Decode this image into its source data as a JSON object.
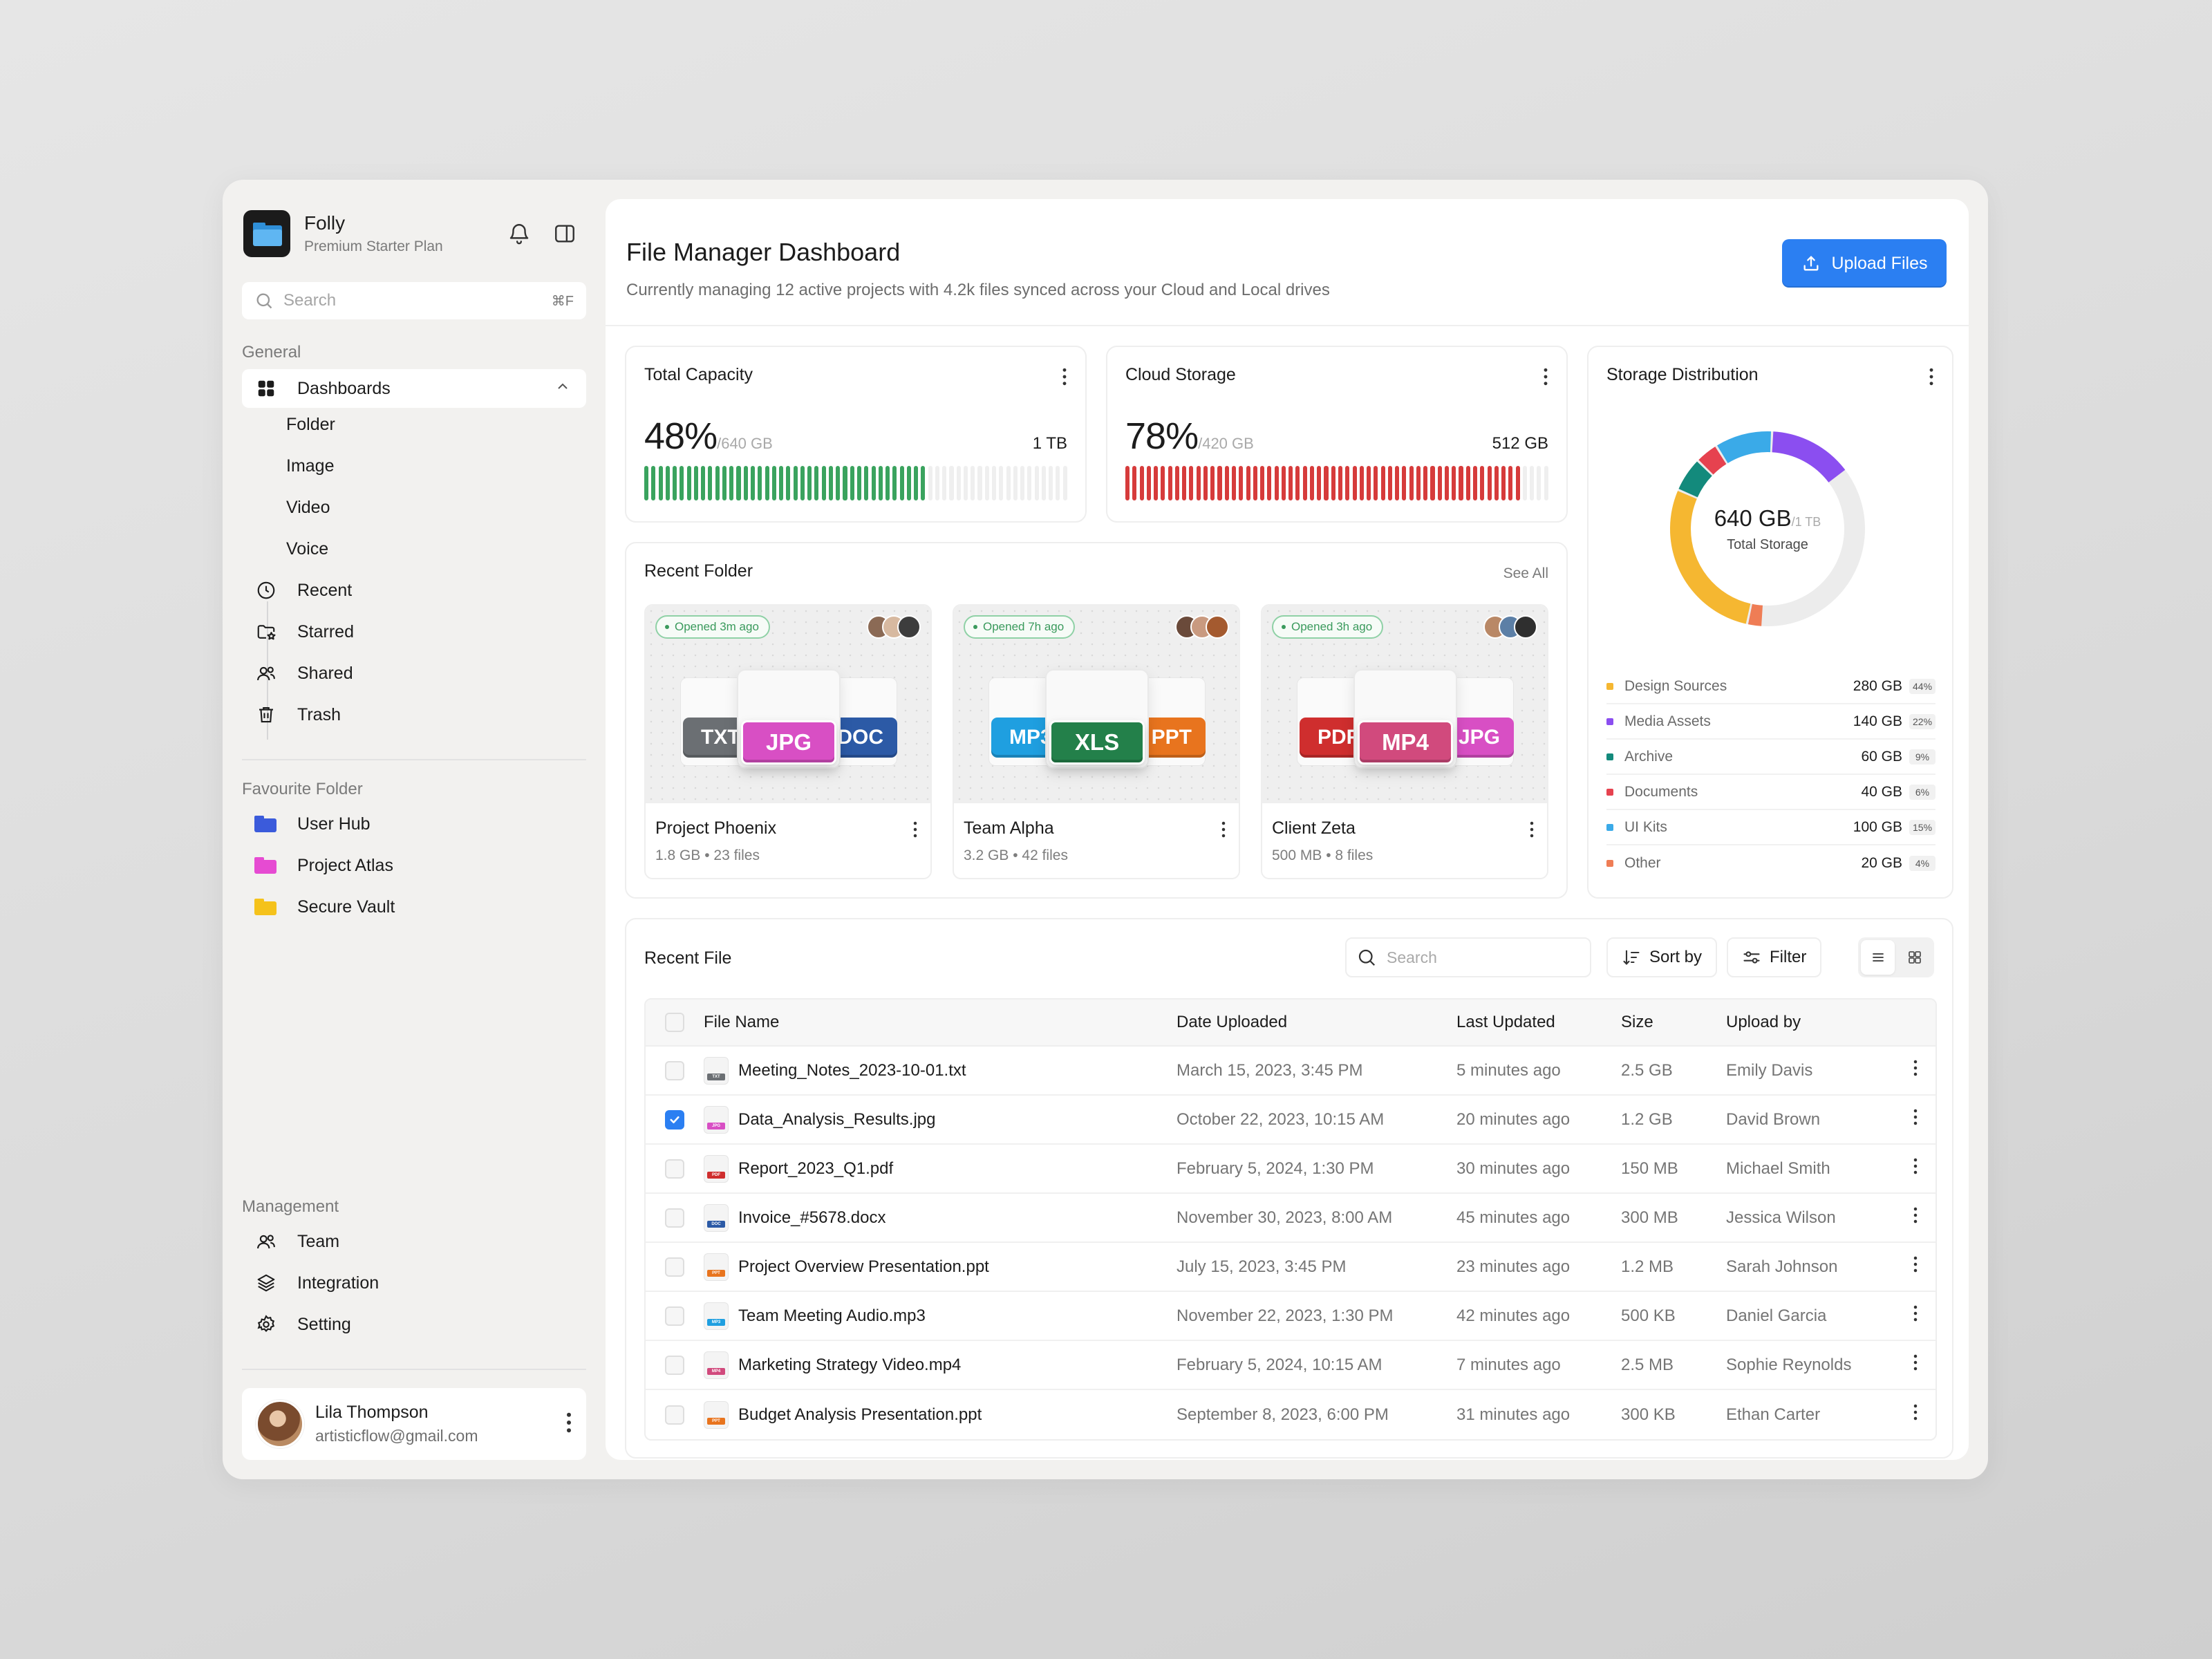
{
  "colors": {
    "accent": "#2b7ff2",
    "capacity_bar": "#3aa35e",
    "cloud_bar": "#d63b3b",
    "txt": "#6b6f73",
    "jpg": "#d84fc4",
    "doc": "#2c5aa6",
    "mp3": "#1f9fe0",
    "xls": "#23804a",
    "ppt": "#e8741e",
    "pdf": "#cf2e2e",
    "mp4": "#d14a7d"
  },
  "app": {
    "name": "Folly",
    "plan": "Premium Starter Plan"
  },
  "sidebar": {
    "search": {
      "placeholder": "Search",
      "shortcut": "⌘F"
    },
    "general_label": "General",
    "dashboards": {
      "label": "Dashboards",
      "children": [
        "Folder",
        "Image",
        "Video",
        "Voice"
      ]
    },
    "nav": [
      {
        "label": "Recent",
        "icon": "clock-icon"
      },
      {
        "label": "Starred",
        "icon": "starred-folder-icon"
      },
      {
        "label": "Shared",
        "icon": "users-icon"
      },
      {
        "label": "Trash",
        "icon": "trash-icon"
      }
    ],
    "favourite_label": "Favourite Folder",
    "favourites": [
      {
        "label": "User Hub",
        "color": "#3b5bdb"
      },
      {
        "label": "Project Atlas",
        "color": "#e64bd2"
      },
      {
        "label": "Secure Vault",
        "color": "#f5c21b"
      }
    ],
    "management_label": "Management",
    "management": [
      {
        "label": "Team",
        "icon": "team-icon"
      },
      {
        "label": "Integration",
        "icon": "layers-icon"
      },
      {
        "label": "Setting",
        "icon": "gear-icon"
      }
    ],
    "user": {
      "name": "Lila Thompson",
      "email": "artisticflow@gmail.com"
    }
  },
  "header": {
    "title": "File Manager Dashboard",
    "subtitle": "Currently managing 12 active projects with 4.2k files synced across your Cloud and Local drives",
    "upload_label": "Upload Files"
  },
  "total_capacity": {
    "title": "Total Capacity",
    "percent": "48%",
    "used": "/640 GB",
    "total": "1 TB",
    "fill_ratio": 0.66
  },
  "cloud_storage": {
    "title": "Cloud Storage",
    "percent": "78%",
    "used": "/420 GB",
    "total": "512 GB",
    "fill_ratio": 0.94
  },
  "storage_distribution": {
    "title": "Storage Distribution",
    "total_value": "640 GB",
    "total_of": "/1 TB",
    "total_label": "Total Storage",
    "items": [
      {
        "name": "Design Sources",
        "size": "280 GB",
        "percent": "44%",
        "color": "#f5b731"
      },
      {
        "name": "Media Assets",
        "size": "140 GB",
        "percent": "22%",
        "color": "#8b4ef0"
      },
      {
        "name": "Archive",
        "size": "60 GB",
        "percent": "9%",
        "color": "#138a7c"
      },
      {
        "name": "Documents",
        "size": "40 GB",
        "percent": "6%",
        "color": "#e6424f"
      },
      {
        "name": "UI Kits",
        "size": "100 GB",
        "percent": "15%",
        "color": "#3aaae8"
      },
      {
        "name": "Other",
        "size": "20 GB",
        "percent": "4%",
        "color": "#ef7d55"
      }
    ]
  },
  "recent_folder": {
    "title": "Recent Folder",
    "see_all": "See All",
    "folders": [
      {
        "name": "Project Phoenix",
        "size": "1.8 GB",
        "files": "23 files",
        "opened": "Opened 3m ago",
        "tags": [
          "TXT",
          "JPG",
          "DOC"
        ],
        "tag_colors": [
          "#6b6f73",
          "#d84fc4",
          "#2c5aa6"
        ]
      },
      {
        "name": "Team Alpha",
        "size": "3.2 GB",
        "files": "42 files",
        "opened": "Opened 7h ago",
        "tags": [
          "MP3",
          "XLS",
          "PPT"
        ],
        "tag_colors": [
          "#1f9fe0",
          "#23804a",
          "#e8741e"
        ]
      },
      {
        "name": "Client Zeta",
        "size": "500 MB",
        "files": "8 files",
        "opened": "Opened 3h ago",
        "tags": [
          "PDF",
          "MP4",
          "JPG"
        ],
        "tag_colors": [
          "#cf2e2e",
          "#d14a7d",
          "#d84fc4"
        ]
      }
    ]
  },
  "recent_file": {
    "title": "Recent File",
    "search_placeholder": "Search",
    "sort_label": "Sort by",
    "filter_label": "Filter",
    "columns": [
      "File Name",
      "Date Uploaded",
      "Last Updated",
      "Size",
      "Upload by"
    ],
    "rows": [
      {
        "name": "Meeting_Notes_2023-10-01.txt",
        "type": "TXT",
        "color": "#6b6f73",
        "date": "March 15, 2023, 3:45 PM",
        "updated": "5 minutes ago",
        "size": "2.5 GB",
        "by": "Emily Davis",
        "checked": false
      },
      {
        "name": "Data_Analysis_Results.jpg",
        "type": "JPG",
        "color": "#d84fc4",
        "date": "October 22, 2023, 10:15 AM",
        "updated": "20 minutes ago",
        "size": "1.2 GB",
        "by": "David Brown",
        "checked": true
      },
      {
        "name": "Report_2023_Q1.pdf",
        "type": "PDF",
        "color": "#cf2e2e",
        "date": "February 5, 2024, 1:30 PM",
        "updated": "30 minutes ago",
        "size": "150 MB",
        "by": "Michael Smith",
        "checked": false
      },
      {
        "name": "Invoice_#5678.docx",
        "type": "DOC",
        "color": "#2c5aa6",
        "date": "November 30, 2023, 8:00 AM",
        "updated": "45 minutes ago",
        "size": "300 MB",
        "by": "Jessica Wilson",
        "checked": false
      },
      {
        "name": "Project Overview Presentation.ppt",
        "type": "PPT",
        "color": "#e8741e",
        "date": "July 15, 2023, 3:45 PM",
        "updated": "23 minutes ago",
        "size": "1.2 MB",
        "by": "Sarah Johnson",
        "checked": false
      },
      {
        "name": "Team Meeting Audio.mp3",
        "type": "MP3",
        "color": "#1f9fe0",
        "date": "November 22, 2023, 1:30 PM",
        "updated": "42 minutes ago",
        "size": "500 KB",
        "by": "Daniel Garcia",
        "checked": false
      },
      {
        "name": "Marketing Strategy Video.mp4",
        "type": "MP4",
        "color": "#d14a7d",
        "date": "February 5, 2024, 10:15 AM",
        "updated": "7 minutes ago",
        "size": "2.5 MB",
        "by": "Sophie Reynolds",
        "checked": false
      },
      {
        "name": "Budget Analysis Presentation.ppt",
        "type": "PPT",
        "color": "#e8741e",
        "date": "September 8, 2023, 6:00 PM",
        "updated": "31 minutes ago",
        "size": "300 KB",
        "by": "Ethan Carter",
        "checked": false
      }
    ]
  }
}
